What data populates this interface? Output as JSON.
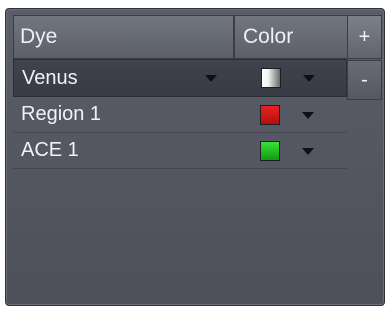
{
  "header": {
    "dye_label": "Dye",
    "color_label": "Color"
  },
  "buttons": {
    "add_label": "+",
    "remove_label": "-"
  },
  "rows": [
    {
      "name": "Venus",
      "color": "gradient-gray",
      "swatch_colors": [
        "#ffffff",
        "#404040"
      ],
      "selected": true
    },
    {
      "name": "Region 1",
      "color": "red",
      "swatch_colors": [
        "#e01a1a",
        "#b80e0e"
      ],
      "selected": false
    },
    {
      "name": "ACE 1",
      "color": "green",
      "swatch_colors": [
        "#2bd42b",
        "#0f9a0f"
      ],
      "selected": false
    }
  ],
  "icons": {
    "dye_dropdown": "chevron-down-icon",
    "color_dropdown": "chevron-down-icon"
  }
}
